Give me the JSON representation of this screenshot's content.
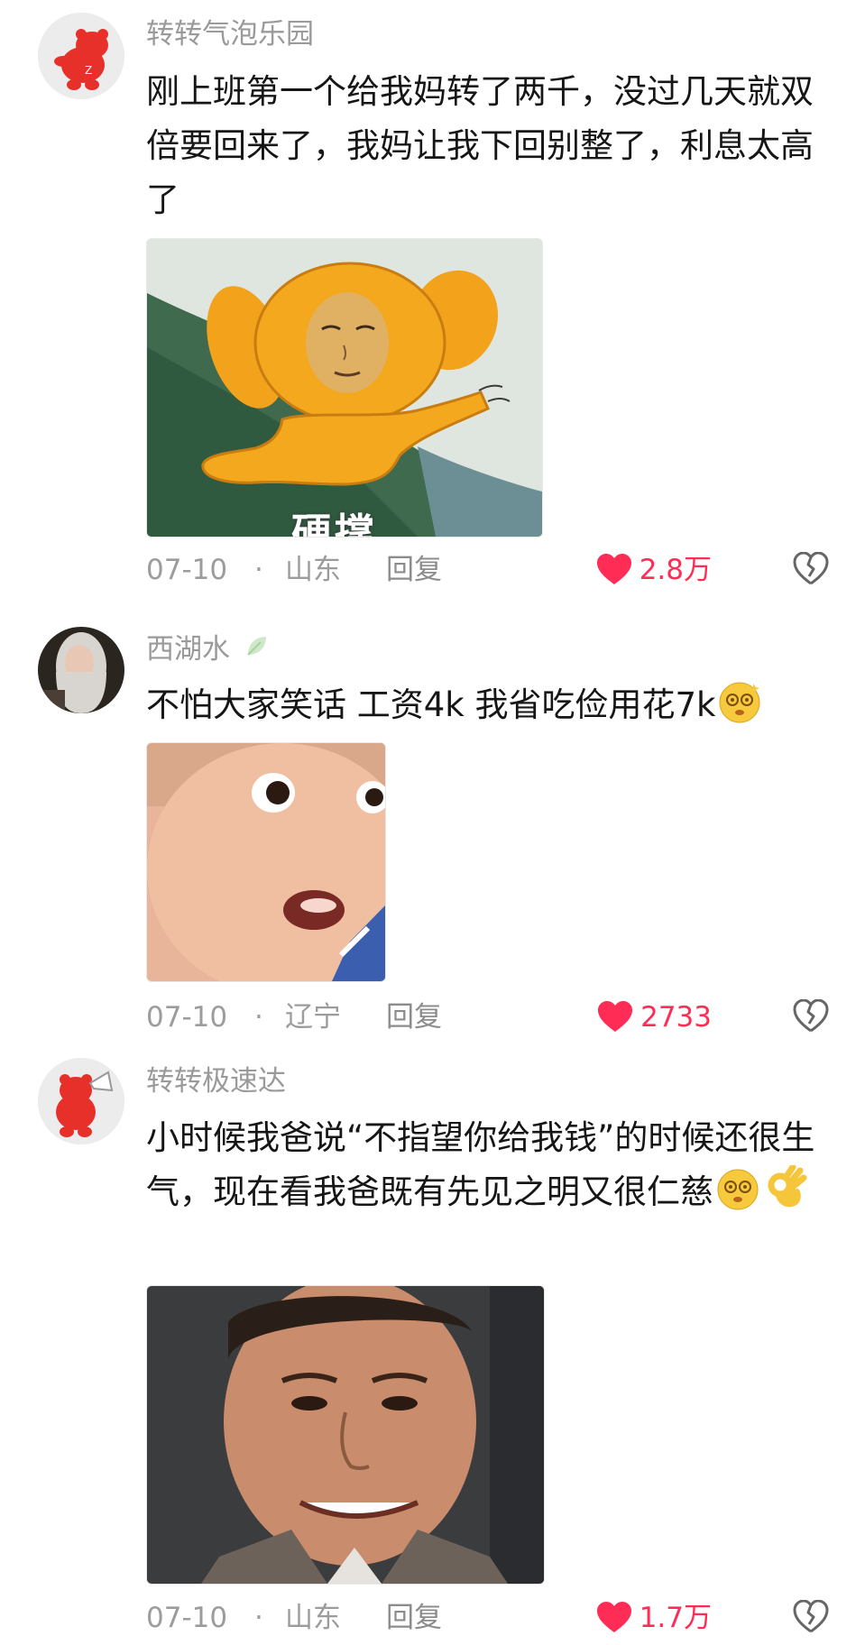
{
  "comments": [
    {
      "username": "转转气泡乐园",
      "text": "刚上班第一个给我妈转了两千，没过几天就双倍要回来了，我妈让我下回别整了，利息太高了",
      "sticker_caption": "硬撑",
      "date": "07-10",
      "separator": "·",
      "location": "山东",
      "reply_label": "回复",
      "likes": "2.8万",
      "avatar": "red-bear-icon"
    },
    {
      "username": "西湖水",
      "badge_icon": "leaf-icon",
      "text": "不怕大家笑话 工资4k 我省吃俭用花7k",
      "trailing_emoji": "dizzy-face-emoji",
      "date": "07-10",
      "separator": "·",
      "location": "辽宁",
      "reply_label": "回复",
      "likes": "2733",
      "avatar": "long-hair-person"
    },
    {
      "username": "转转极速达",
      "text": "小时候我爸说“不指望你给我钱”的时候还很生气，现在看我爸既有先见之明又很仁慈",
      "trailing_emoji": [
        "dizzy-face-emoji",
        "ok-hand-emoji"
      ],
      "date": "07-10",
      "separator": "·",
      "location": "山东",
      "reply_label": "回复",
      "likes": "1.7万",
      "avatar": "red-bear-megaphone-icon"
    }
  ],
  "colors": {
    "like": "#ff2d55",
    "meta": "#9c9c9c",
    "username": "#9a9a9a"
  }
}
